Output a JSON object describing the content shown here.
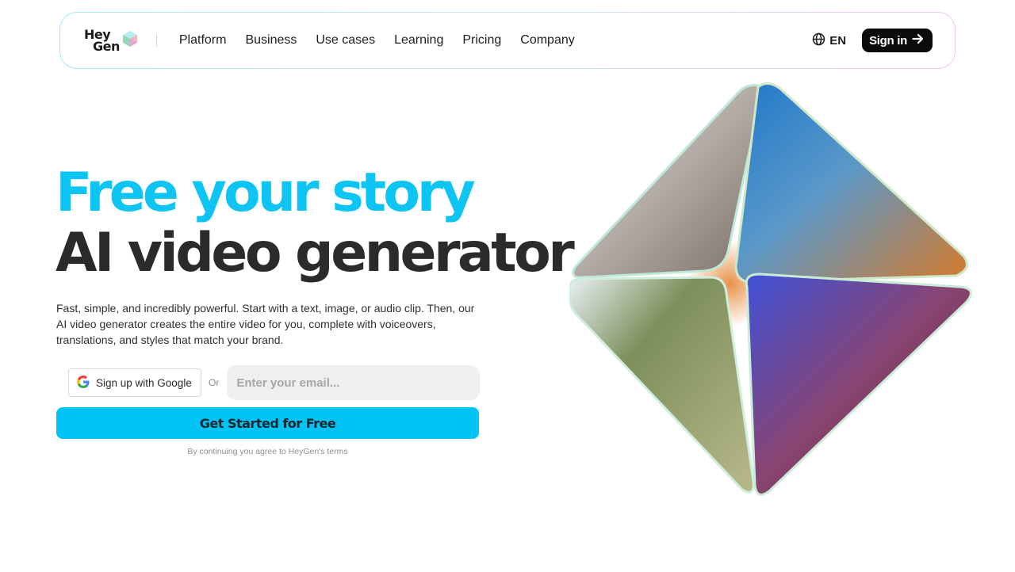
{
  "brand": {
    "line1": "Hey",
    "line2": "Gen"
  },
  "nav": {
    "links": [
      "Platform",
      "Business",
      "Use cases",
      "Learning",
      "Pricing",
      "Company"
    ],
    "language": "EN",
    "signin_label": "Sign in"
  },
  "hero": {
    "title_line1": "Free your story",
    "title_line2": "AI video generator",
    "description": "Fast, simple, and incredibly powerful. Start with a text, image, or audio clip. Then, our AI video generator creates the entire video for you, complete with voiceovers, translations, and styles that match your brand."
  },
  "signup": {
    "google_label": "Sign up with Google",
    "or_label": "Or",
    "email_placeholder": "Enter your email...",
    "cta_label": "Get Started for Free",
    "terms": "By continuing you agree to HeyGen's terms"
  },
  "colors": {
    "accent": "#0ec4f2",
    "cta": "#00c4f5",
    "heading_dark": "#2b2b2b",
    "signin_bg": "#0b0b0b"
  },
  "icons": {
    "logo": "heygen-cube-logo",
    "language": "globe-icon",
    "signin": "arrow-right-icon",
    "google": "google-g-icon"
  }
}
